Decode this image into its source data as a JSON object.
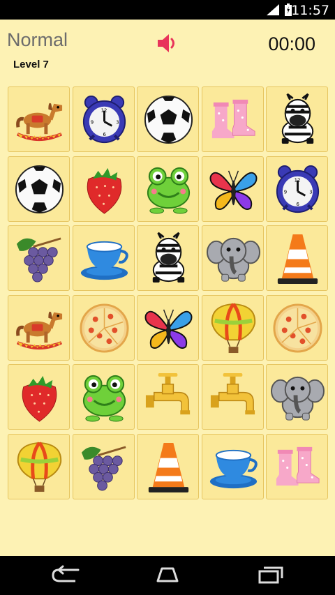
{
  "status_bar": {
    "time": "11:57"
  },
  "header": {
    "mode": "Normal",
    "level": "Level 7",
    "timer": "00:00"
  },
  "board": {
    "rows": 6,
    "cols": 5,
    "cards": [
      "rocking-horse",
      "alarm-clock",
      "soccer-ball",
      "rain-boots",
      "zebra",
      "soccer-ball",
      "strawberry",
      "frog",
      "butterfly",
      "alarm-clock",
      "grapes",
      "teacup",
      "zebra",
      "elephant",
      "traffic-cone",
      "rocking-horse",
      "pizza",
      "butterfly",
      "hot-air-balloon",
      "pizza",
      "strawberry",
      "frog",
      "water-tap",
      "water-tap",
      "elephant",
      "hot-air-balloon",
      "grapes",
      "traffic-cone",
      "teacup",
      "rain-boots"
    ]
  },
  "icons": {
    "sound": "speaker-icon",
    "nav_back": "back-icon",
    "nav_home": "home-icon",
    "nav_recents": "recents-icon"
  },
  "colors": {
    "background": "#fdf2b4",
    "card": "#fbe99a",
    "card_border": "#e6c560",
    "sound": "#e8345a"
  }
}
